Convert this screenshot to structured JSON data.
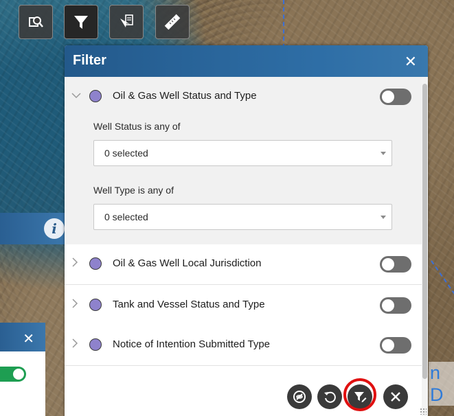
{
  "colors": {
    "header_blue": "#2e6ea6",
    "dot_purple": "#8e82cc",
    "toggle_off": "#6e6e6e",
    "toggle_on": "#1e9e52",
    "highlight_red": "#e01010"
  },
  "toolbar": {
    "buttons": [
      {
        "icon": "layer-search-icon"
      },
      {
        "icon": "filter-icon"
      },
      {
        "icon": "select-tool-icon"
      },
      {
        "icon": "measure-ruler-icon"
      }
    ]
  },
  "map": {
    "partial_label": "n D"
  },
  "filter_panel": {
    "title": "Filter",
    "close_symbol": "✕",
    "layers": [
      {
        "label": "Oil & Gas Well Status and Type",
        "expanded": true,
        "enabled": false,
        "fields": [
          {
            "label": "Well Status is any of",
            "value": "0 selected"
          },
          {
            "label": "Well Type is any of",
            "value": "0 selected"
          }
        ]
      },
      {
        "label": "Oil & Gas Well Local Jurisdiction",
        "expanded": false,
        "enabled": false
      },
      {
        "label": "Tank and Vessel Status and Type",
        "expanded": false,
        "enabled": false
      },
      {
        "label": "Notice of Intention Submitted Type",
        "expanded": false,
        "enabled": false
      }
    ],
    "footer_buttons": [
      {
        "icon": "turn-off-filters-icon"
      },
      {
        "icon": "reset-icon"
      },
      {
        "icon": "filter-edit-icon",
        "highlighted": true
      },
      {
        "icon": "close-circle-icon"
      }
    ]
  },
  "left_panel": {
    "close_symbol": "✕",
    "toggle_enabled": true
  },
  "info_icon": {
    "glyph": "i"
  }
}
